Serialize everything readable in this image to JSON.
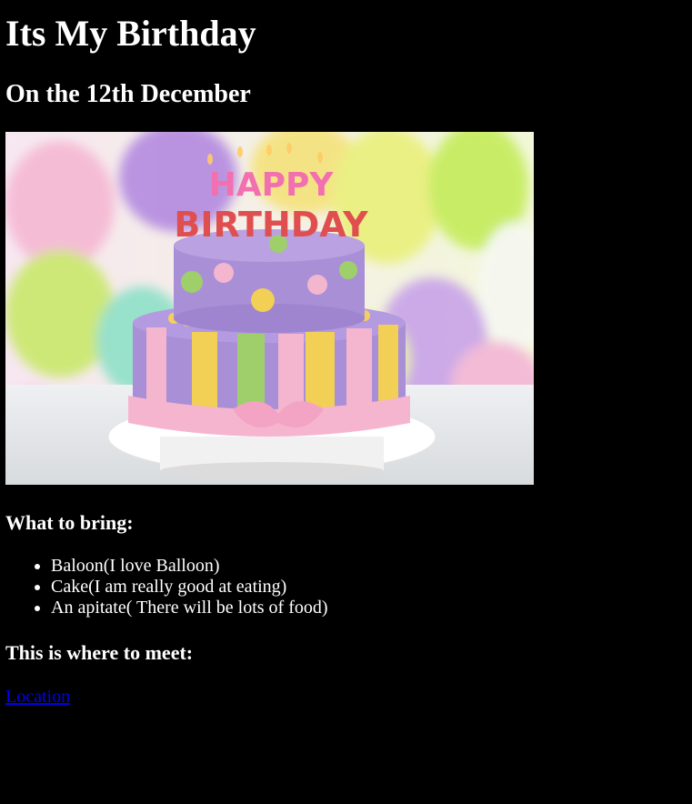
{
  "page": {
    "title": "Its My Birthday",
    "subtitle": "On the 12th December",
    "image_alt": "HAPPY BIRTHDAY",
    "bring_heading": "What to bring:",
    "bring_items": [
      "Baloon(I love Balloon)",
      "Cake(I am really good at eating)",
      "An apitate( There will be lots of food)"
    ],
    "meet_heading": "This is where to meet:",
    "location_link": "Location",
    "cake_text_top": "HAPPY",
    "cake_text_bottom": "BIRTHDAY"
  },
  "colors": {
    "background": "#000000",
    "text": "#ffffff",
    "link": "#0000ee",
    "cake_purple": "#a98fd6",
    "cake_pink": "#f4b6cf",
    "cake_yellow": "#f2cf55",
    "cake_green": "#9fcf6a"
  }
}
